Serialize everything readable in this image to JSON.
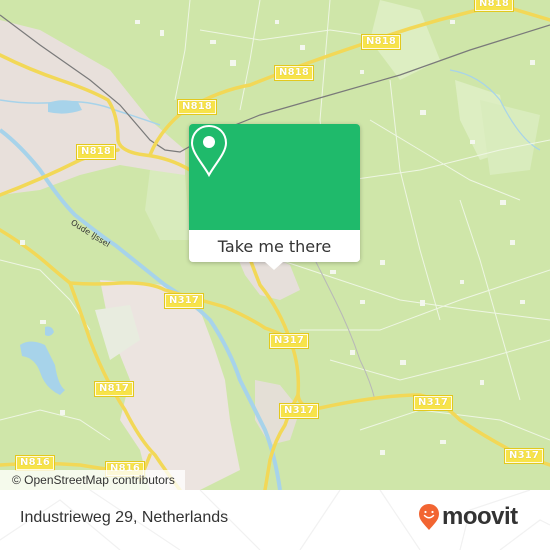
{
  "map": {
    "road_labels": [
      {
        "id": "n818-1",
        "text": "N818"
      },
      {
        "id": "n818-2",
        "text": "N818"
      },
      {
        "id": "n818-3",
        "text": "N818"
      },
      {
        "id": "n818-4",
        "text": "N818"
      },
      {
        "id": "n818-5",
        "text": "N818"
      },
      {
        "id": "n317-1",
        "text": "N317"
      },
      {
        "id": "n317-2",
        "text": "N317"
      },
      {
        "id": "n317-3",
        "text": "N317"
      },
      {
        "id": "n317-4",
        "text": "N317"
      },
      {
        "id": "n317-5",
        "text": "N317"
      },
      {
        "id": "n817-1",
        "text": "N817"
      },
      {
        "id": "n816-1",
        "text": "N816"
      },
      {
        "id": "n816-2",
        "text": "N816"
      }
    ],
    "place_labels": {
      "river": "Oude IJssel"
    },
    "attribution": "© OpenStreetMap contributors"
  },
  "popup": {
    "icon": "map-pin-icon",
    "button_label": "Take me there",
    "color": "#1fba6b"
  },
  "footer": {
    "address": "Industrieweg 29, Netherlands",
    "brand": "moovit",
    "brand_color": "#f26532"
  }
}
